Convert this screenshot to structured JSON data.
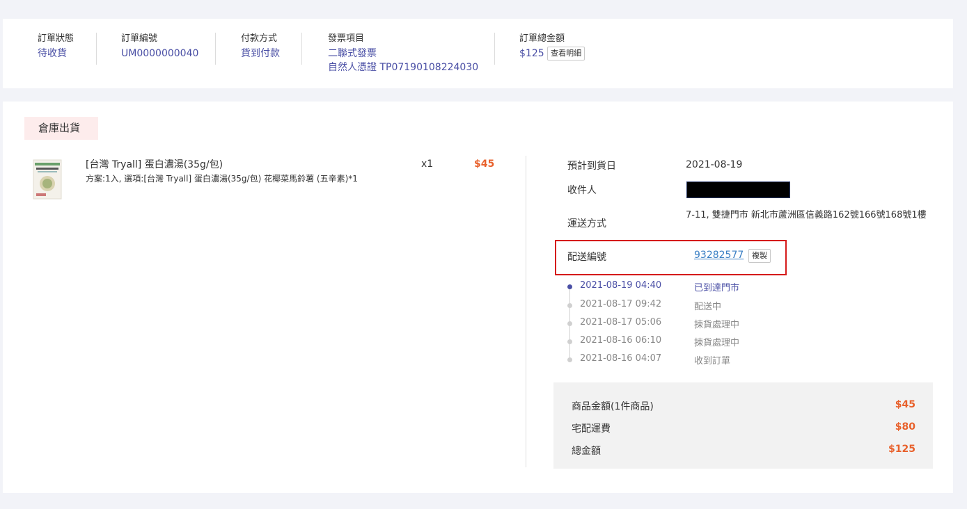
{
  "summary": {
    "status": {
      "label": "訂單狀態",
      "value": "待收貨"
    },
    "order_no": {
      "label": "訂單編號",
      "value": "UM0000000040"
    },
    "payment": {
      "label": "付款方式",
      "value": "貨到付款"
    },
    "invoice": {
      "label": "發票項目",
      "type": "二聯式發票",
      "carrier": "自然人憑證 TP07190108224030"
    },
    "total": {
      "label": "訂單總金額",
      "value": "$125",
      "detail_button": "查看明細"
    }
  },
  "shipment": {
    "tag": "倉庫出貨",
    "product": {
      "name": "[台灣 Tryall] 蛋白濃湯(35g/包)",
      "option": "方案:1入, 選項:[台灣 Tryall] 蛋白濃湯(35g/包) 花椰菜馬鈴薯 (五辛素)*1",
      "qty": "x1",
      "price": "$45"
    },
    "info": {
      "eta_label": "預計到貨日",
      "eta_value": "2021-08-19",
      "recipient_label": "收件人",
      "method_label": "運送方式",
      "method_value": "7-11, 雙捷門市 新北市蘆洲區信義路162號166號168號1樓",
      "tracking_label": "配送編號",
      "tracking_value": "93282577",
      "copy_button": "複製"
    },
    "timeline": [
      {
        "time": "2021-08-19 04:40",
        "status": "已到達門市"
      },
      {
        "time": "2021-08-17 09:42",
        "status": "配送中"
      },
      {
        "time": "2021-08-17 05:06",
        "status": "揀貨處理中"
      },
      {
        "time": "2021-08-16 06:10",
        "status": "揀貨處理中"
      },
      {
        "time": "2021-08-16 04:07",
        "status": "收到訂單"
      }
    ],
    "totals": {
      "subtotal_label": "商品金額(1件商品)",
      "subtotal_value": "$45",
      "shipping_label": "宅配運費",
      "shipping_value": "$80",
      "total_label": "總金額",
      "total_value": "$125"
    }
  },
  "colors": {
    "accent": "#4a4fa5",
    "price": "#e8612c",
    "highlight_border": "#d51a1a",
    "tag_bg": "#fdecec"
  }
}
